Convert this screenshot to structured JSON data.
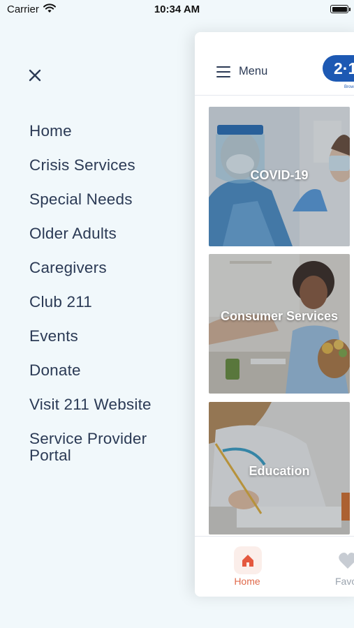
{
  "status_bar": {
    "carrier": "Carrier",
    "time": "10:34 AM"
  },
  "side_menu": {
    "items": [
      {
        "label": "Home"
      },
      {
        "label": "Crisis Services"
      },
      {
        "label": "Special Needs"
      },
      {
        "label": "Older Adults"
      },
      {
        "label": "Caregivers"
      },
      {
        "label": "Club 211"
      },
      {
        "label": "Events"
      },
      {
        "label": "Donate"
      },
      {
        "label": "Visit 211 Website"
      },
      {
        "label": "Service Provider Portal"
      }
    ]
  },
  "header": {
    "menu_label": "Menu",
    "logo_text": "2·1",
    "logo_sub": "Brow"
  },
  "cards": [
    {
      "label": "COVID-19"
    },
    {
      "label": "Consumer Services"
    },
    {
      "label": "Education"
    }
  ],
  "tab_bar": {
    "home_label": "Home",
    "fav_label": "Favo"
  },
  "colors": {
    "background": "#f1f8fb",
    "menu_text": "#2b3a55",
    "brand_blue": "#1d59b3",
    "active_tab": "#e06a4b"
  }
}
